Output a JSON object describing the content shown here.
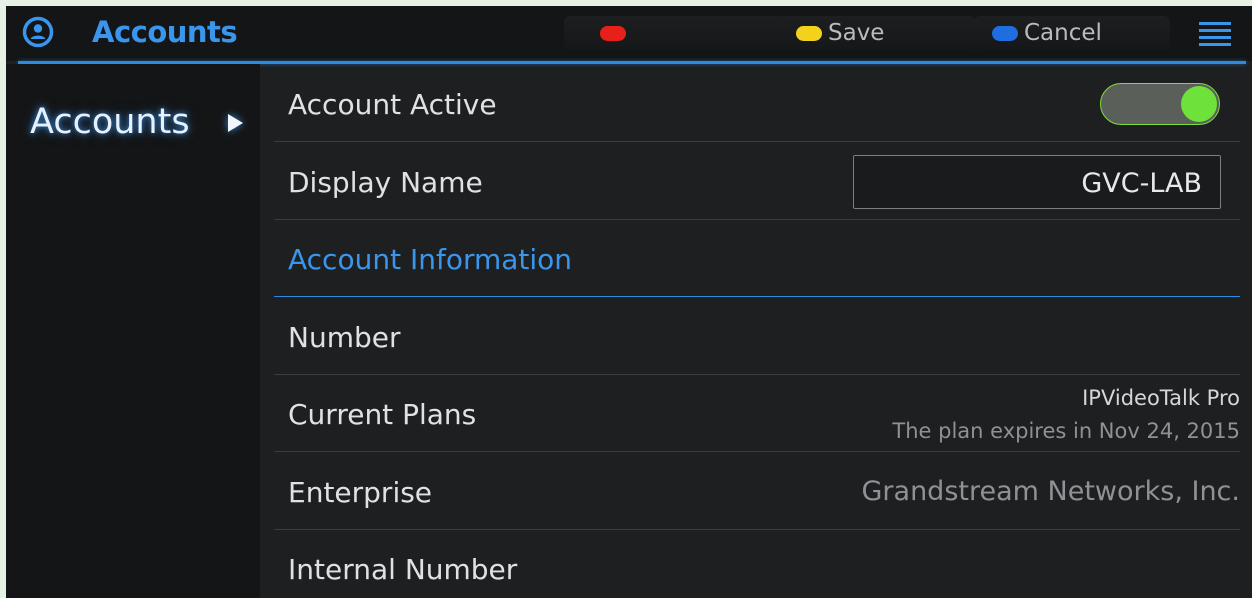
{
  "header": {
    "title": "Accounts",
    "icon": "account-circle-icon",
    "softkeys": [
      {
        "color": "#e8201a",
        "label": ""
      },
      {
        "color": "#f2d21a",
        "label": "Save"
      },
      {
        "color": "#1f6ee0",
        "label": "Cancel"
      }
    ],
    "menu_icon": "menu-icon"
  },
  "sidebar": {
    "items": [
      {
        "label": "Accounts",
        "selected": true
      }
    ]
  },
  "settings": {
    "account_active": {
      "label": "Account Active",
      "value": true
    },
    "display_name": {
      "label": "Display Name",
      "value": "GVC-LAB"
    },
    "section_title": "Account Information",
    "number": {
      "label": "Number",
      "value": ""
    },
    "current_plans": {
      "label": "Current Plans",
      "plan": "IPVideoTalk Pro",
      "expiry": "The plan expires in Nov 24, 2015"
    },
    "enterprise": {
      "label": "Enterprise",
      "value": "Grandstream Networks, Inc."
    },
    "internal_number": {
      "label": "Internal Number",
      "value": ""
    }
  },
  "colors": {
    "accent": "#2c8ae0",
    "toggle_on": "#6ee23a"
  }
}
